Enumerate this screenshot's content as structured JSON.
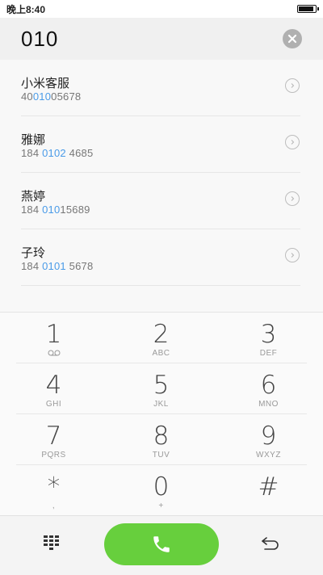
{
  "status_bar": {
    "time": "晚上8:40",
    "battery_level": 0.95
  },
  "dial": {
    "number": "010"
  },
  "contacts": [
    {
      "name": "小米客服",
      "number_pre": "40",
      "number_hl": "010",
      "number_post": "05678"
    },
    {
      "name": "雅娜",
      "number_pre": "184 ",
      "number_hl": "0102",
      "number_post": " 4685"
    },
    {
      "name": "燕婷",
      "number_pre": "184 ",
      "number_hl": "010",
      "number_post": "15689"
    },
    {
      "name": "子玲",
      "number_pre": "184 ",
      "number_hl": "0101",
      "number_post": " 5678"
    }
  ],
  "keypad": [
    {
      "digit": "1",
      "letters": ""
    },
    {
      "digit": "2",
      "letters": "ABC"
    },
    {
      "digit": "3",
      "letters": "DEF"
    },
    {
      "digit": "4",
      "letters": "GHI"
    },
    {
      "digit": "5",
      "letters": "JKL"
    },
    {
      "digit": "6",
      "letters": "MNO"
    },
    {
      "digit": "7",
      "letters": "PQRS"
    },
    {
      "digit": "8",
      "letters": "TUV"
    },
    {
      "digit": "9",
      "letters": "WXYZ"
    },
    {
      "digit": "*",
      "letters": ","
    },
    {
      "digit": "0",
      "letters": "+"
    },
    {
      "digit": "#",
      "letters": ""
    }
  ],
  "icons": {
    "voicemail": "voicemail-icon",
    "clear": "clear-icon",
    "contact_detail": "chevron-right-icon",
    "call": "phone-icon",
    "keypad_toggle": "keypad-grid-icon",
    "back": "back-arrow-icon"
  },
  "colors": {
    "call_green": "#67cf3d",
    "highlight_blue": "#4a9be8"
  }
}
